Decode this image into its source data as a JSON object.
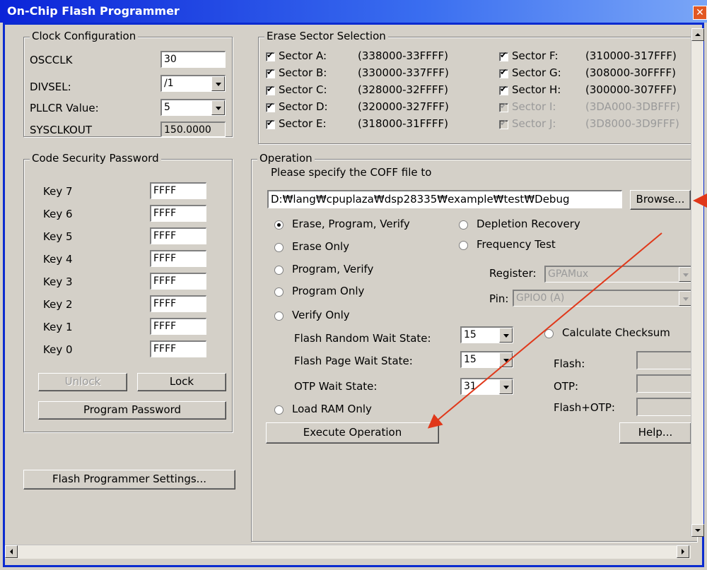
{
  "window": {
    "title": "On-Chip Flash Programmer",
    "close_glyph": "✕"
  },
  "clock": {
    "legend": "Clock Configuration",
    "osc_label": "OSCCLK",
    "osc_value": "30",
    "divsel_label": "DIVSEL:",
    "divsel_value": "/1",
    "pllcr_label": "PLLCR Value:",
    "pllcr_value": "5",
    "sysclk_label": "SYSCLKOUT",
    "sysclk_value": "150.0000"
  },
  "security": {
    "legend": "Code Security Password",
    "keys": [
      {
        "label": "Key 7",
        "value": "FFFF"
      },
      {
        "label": "Key 6",
        "value": "FFFF"
      },
      {
        "label": "Key 5",
        "value": "FFFF"
      },
      {
        "label": "Key 4",
        "value": "FFFF"
      },
      {
        "label": "Key 3",
        "value": "FFFF"
      },
      {
        "label": "Key 2",
        "value": "FFFF"
      },
      {
        "label": "Key 1",
        "value": "FFFF"
      },
      {
        "label": "Key 0",
        "value": "FFFF"
      }
    ],
    "unlock_label": "Unlock",
    "lock_label": "Lock",
    "program_password_label": "Program Password"
  },
  "settings_button": "Flash Programmer Settings...",
  "erase": {
    "legend": "Erase Sector Selection",
    "sectors": [
      {
        "name": "Sector A:",
        "range": "(338000-33FFFF)",
        "checked": true,
        "enabled": true
      },
      {
        "name": "Sector B:",
        "range": "(330000-337FFF)",
        "checked": true,
        "enabled": true
      },
      {
        "name": "Sector C:",
        "range": "(328000-32FFFF)",
        "checked": true,
        "enabled": true
      },
      {
        "name": "Sector D:",
        "range": "(320000-327FFF)",
        "checked": true,
        "enabled": true
      },
      {
        "name": "Sector E:",
        "range": "(318000-31FFFF)",
        "checked": true,
        "enabled": true
      },
      {
        "name": "Sector F:",
        "range": "(310000-317FFF)",
        "checked": true,
        "enabled": true
      },
      {
        "name": "Sector G:",
        "range": "(308000-30FFFF)",
        "checked": true,
        "enabled": true
      },
      {
        "name": "Sector H:",
        "range": "(300000-307FFF)",
        "checked": true,
        "enabled": true
      },
      {
        "name": "Sector I:",
        "range": "(3DA000-3DBFFF)",
        "checked": true,
        "enabled": false
      },
      {
        "name": "Sector J:",
        "range": "(3D8000-3D9FFF)",
        "checked": true,
        "enabled": false
      }
    ]
  },
  "operation": {
    "legend": "Operation",
    "coff_prompt": "Please specify the COFF file to",
    "coff_path": "D:₩lang₩cpuplaza₩dsp28335₩example₩test₩Debug",
    "browse_label": "Browse...",
    "radios_left": [
      {
        "label": "Erase, Program, Verify",
        "selected": true
      },
      {
        "label": "Erase Only",
        "selected": false
      },
      {
        "label": "Program, Verify",
        "selected": false
      },
      {
        "label": "Program Only",
        "selected": false
      },
      {
        "label": "Verify Only",
        "selected": false
      }
    ],
    "radio_depletion": "Depletion Recovery",
    "radio_frequency": "Frequency Test",
    "register_label": "Register:",
    "register_value": "GPAMux",
    "pin_label": "Pin:",
    "pin_value": "GPIO0 (A)",
    "random_wait_label": "Flash Random Wait State:",
    "random_wait_value": "15",
    "page_wait_label": "Flash Page Wait State:",
    "page_wait_value": "15",
    "otp_wait_label": "OTP Wait State:",
    "otp_wait_value": "31",
    "checksum_label": "Calculate Checksum",
    "flash_label": "Flash:",
    "otp_label": "OTP:",
    "flashotp_label": "Flash+OTP:",
    "load_ram_label": "Load RAM Only",
    "execute_label": "Execute Operation",
    "help_label": "Help..."
  },
  "colors": {
    "annotation_arrow": "#e0381a",
    "titlebar": "#0b24d8"
  }
}
